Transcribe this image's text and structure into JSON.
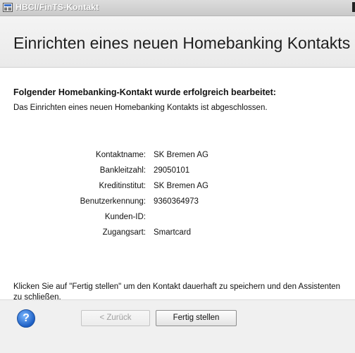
{
  "window": {
    "title": "HBCI/FinTS-Kontakt",
    "icon": "app-window-icon"
  },
  "header": {
    "title": "Einrichten eines neuen Homebanking Kontakts"
  },
  "content": {
    "heading": "Folgender Homebanking-Kontakt wurde erfolgreich bearbeitet:",
    "intro": "Das Einrichten eines neuen Homebanking Kontakts ist abgeschlossen.",
    "fields": [
      {
        "label": "Kontaktname:",
        "value": "SK Bremen AG"
      },
      {
        "label": "Bankleitzahl:",
        "value": "29050101"
      },
      {
        "label": "Kreditinstitut:",
        "value": "SK Bremen AG"
      },
      {
        "label": "Benutzerkennung:",
        "value": "9360364973"
      },
      {
        "label": "Kunden-ID:",
        "value": ""
      },
      {
        "label": "Zugangsart:",
        "value": "Smartcard"
      }
    ],
    "footer_note": "Klicken Sie auf \"Fertig stellen\" um den Kontakt dauerhaft zu speichern und den Assistenten zu schließen."
  },
  "buttons": {
    "help_symbol": "?",
    "back_label": "< Zurück",
    "finish_label": "Fertig stellen"
  }
}
